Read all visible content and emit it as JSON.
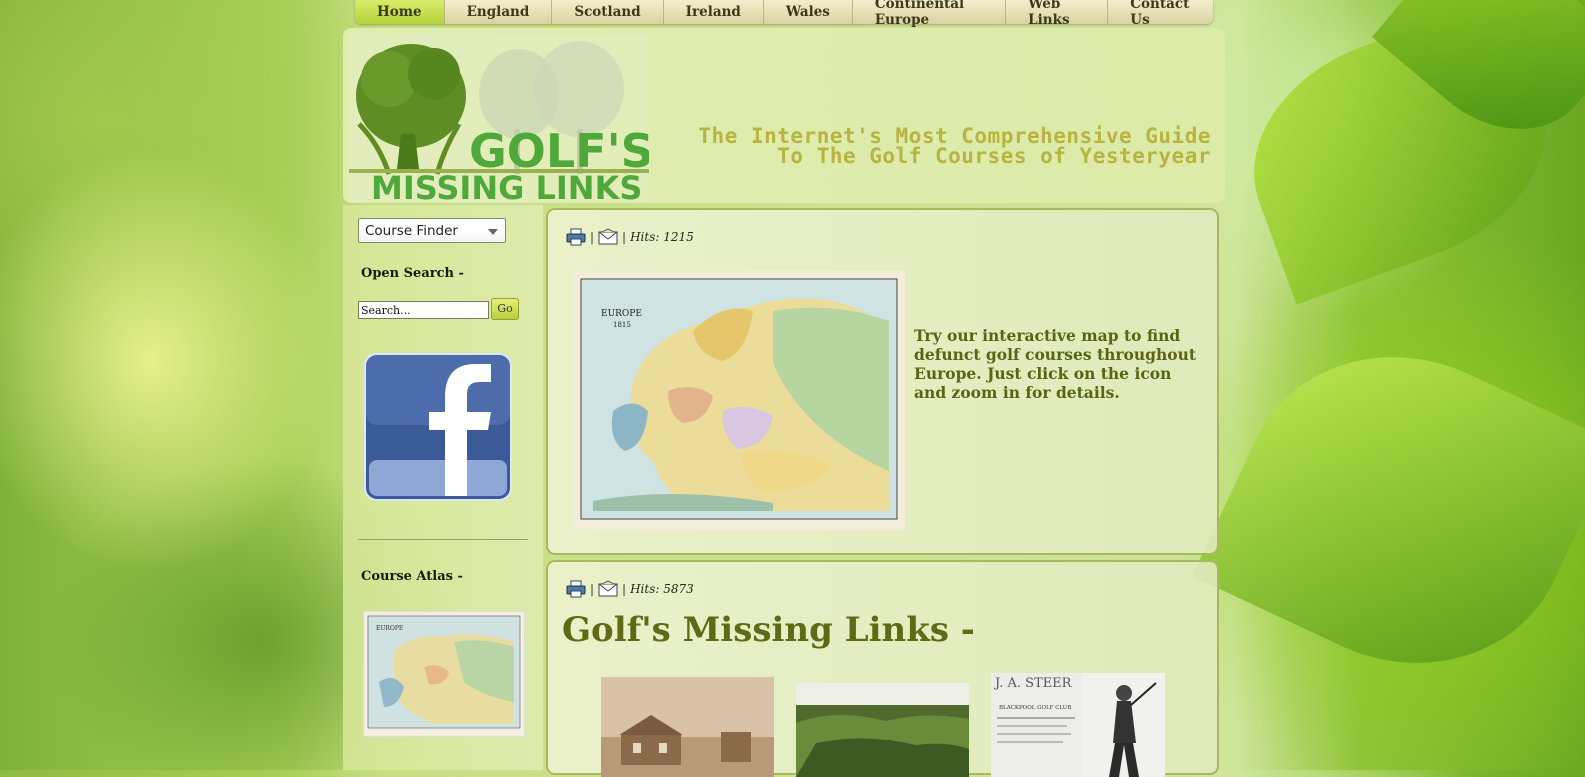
{
  "nav": {
    "items": [
      {
        "label": "Home",
        "active": true
      },
      {
        "label": "England"
      },
      {
        "label": "Scotland"
      },
      {
        "label": "Ireland"
      },
      {
        "label": "Wales"
      },
      {
        "label": "Continental Europe"
      },
      {
        "label": "Web Links"
      },
      {
        "label": "Contact Us"
      }
    ]
  },
  "header": {
    "logo_text_1": "GOLF'S",
    "logo_text_2": "MISSING LINKS",
    "tagline_line1": "The Internet's Most Comprehensive Guide",
    "tagline_line2": "To The Golf Courses of Yesteryear"
  },
  "sidebar": {
    "course_finder": "Course Finder",
    "open_search_title": "Open Search -",
    "search_placeholder": "Search...",
    "search_value": "Search...",
    "go_label": "Go",
    "course_atlas_title": "Course Atlas -"
  },
  "article1": {
    "hits": "Hits: 1215",
    "map_label": "EUROPE",
    "map_year": "1815",
    "text": "Try our interactive map to find defunct golf courses throughout Europe. Just click on the icon and zoom in for details."
  },
  "article2": {
    "hits": "Hits: 5873",
    "title": "Golf's Missing Links -",
    "thumb3_text": "J. A. STEER",
    "thumb3_sub": "BLACKPOOL GOLF CLUB"
  },
  "colors": {
    "nav_active": "#c8df4e",
    "title_olive": "#5e6a14",
    "tagline": "#b7b440",
    "panel_border": "#a8b860"
  },
  "icons": [
    "printer-icon",
    "email-icon",
    "facebook-icon",
    "chevron-down-icon"
  ]
}
